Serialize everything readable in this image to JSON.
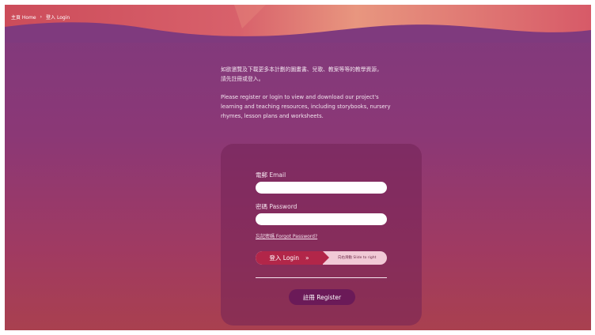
{
  "breadcrumb": {
    "home": "主頁 Home",
    "separator": "›",
    "current": "登入 Login"
  },
  "intro": {
    "zh_line1": "如欲瀏覽及下載更多本計劃的圖畫書、兒歌、教案等等的教學資源，",
    "zh_line2": "請先註冊或登入。",
    "en_line1": "Please register or login to view and download our project's",
    "en_line2": "learning and teaching resources, including storybooks, nursery",
    "en_line3": "rhymes, lesson plans and worksheets."
  },
  "form": {
    "email_label": "電郵 Email",
    "email_value": "",
    "password_label": "密碼 Password",
    "password_value": "",
    "forgot_link": "忘記密碼 Forgot Password?",
    "login_label": "登入 Login",
    "login_icon": "»",
    "slide_hint": "向右滑動 Slide to right",
    "register_label": "註冊 Register"
  },
  "colors": {
    "page_top": "#7f3a7e",
    "page_bottom": "#a9404f",
    "login_knob": "#b22649",
    "slider_track": "#f1c9d6",
    "register_button": "#6b1a58"
  }
}
